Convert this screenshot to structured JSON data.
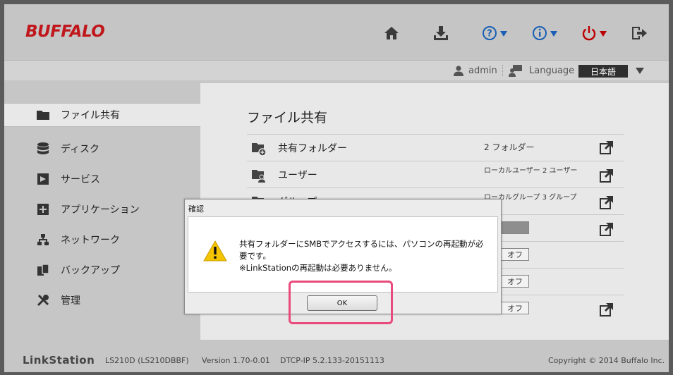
{
  "brand": {
    "logo": "BUFFALO"
  },
  "header_icons": [
    "home-icon",
    "download-icon",
    "help-icon",
    "info-icon",
    "power-icon",
    "logout-icon"
  ],
  "userbar": {
    "user": "admin",
    "language_label": "Language",
    "language_value": "日本語"
  },
  "sidebar": {
    "items": [
      {
        "label": "ファイル共有",
        "icon": "folder-icon",
        "active": true
      },
      {
        "label": "ディスク",
        "icon": "disk-icon",
        "active": false
      },
      {
        "label": "サービス",
        "icon": "service-icon",
        "active": false
      },
      {
        "label": "アプリケーション",
        "icon": "application-icon",
        "active": false
      },
      {
        "label": "ネットワーク",
        "icon": "network-icon",
        "active": false
      },
      {
        "label": "バックアップ",
        "icon": "backup-icon",
        "active": false
      },
      {
        "label": "管理",
        "icon": "tools-icon",
        "active": false
      }
    ]
  },
  "content": {
    "title": "ファイル共有",
    "rows": [
      {
        "label": "共有フォルダー",
        "value": "2 フォルダー"
      },
      {
        "label": "ユーザー",
        "value": "ローカルユーザー 2 ユーザー"
      },
      {
        "label": "グループ",
        "value": "ローカルグループ 3 グループ"
      }
    ],
    "toggles": [
      "オフ",
      "オフ",
      "オフ"
    ]
  },
  "footer": {
    "brand": "LinkStation",
    "model": "LS210D (LS210DBBF)",
    "version": "Version 1.70-0.01",
    "dtcp": "DTCP-IP 5.2.133-20151113",
    "copyright": "Copyright © 2014 Buffalo Inc."
  },
  "dialog": {
    "title": "確認",
    "message_line1": "共有フォルダーにSMBでアクセスするには、パソコンの再起動が必",
    "message_line2": "要です。",
    "message_line3": "※LinkStationの再起動は必要ありません。",
    "ok_label": "OK"
  },
  "colors": {
    "logo_red": "#c0171c",
    "icon_blue": "#1a5fb4",
    "highlight": "#e84a7c"
  }
}
